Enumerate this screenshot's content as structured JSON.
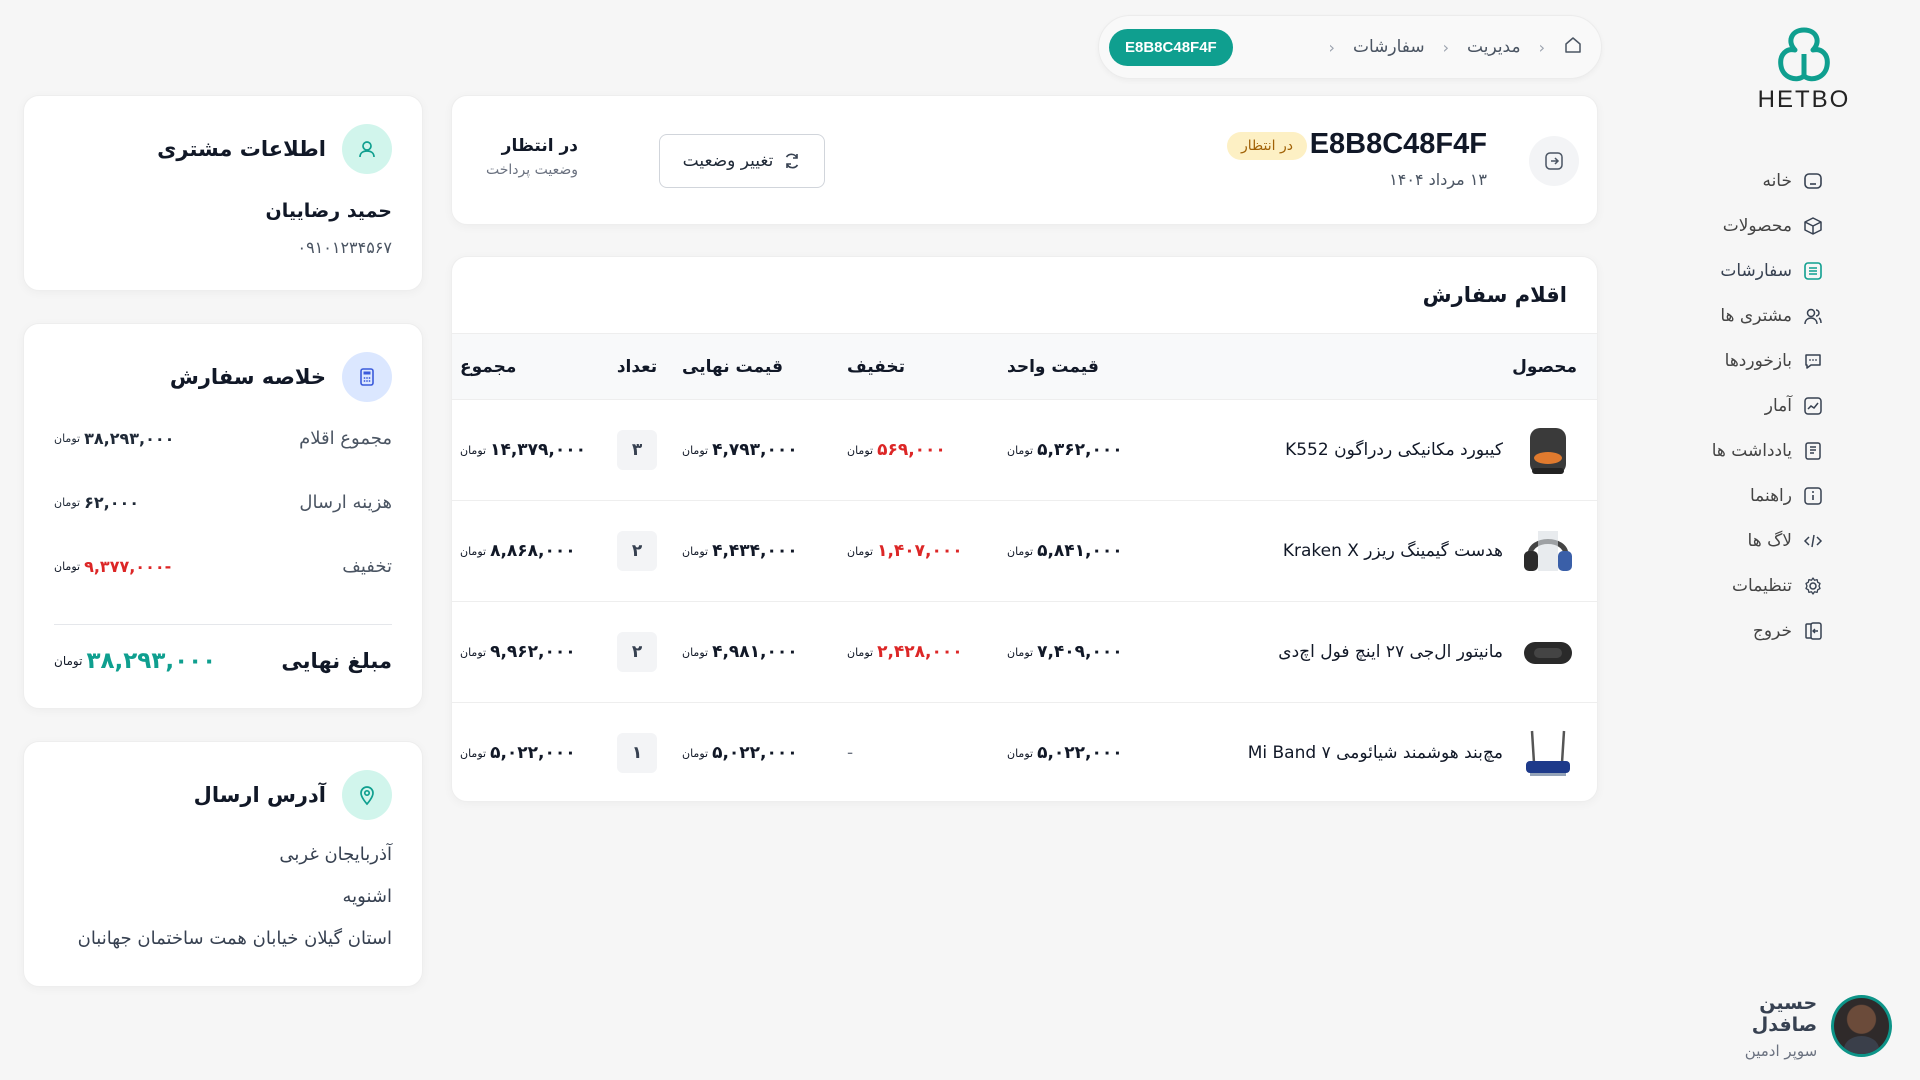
{
  "brand": {
    "name": "HETBO",
    "color": "#0f9f8f"
  },
  "sidebar": {
    "items": [
      {
        "label": "خانه",
        "icon": "home-icon"
      },
      {
        "label": "محصولات",
        "icon": "box-icon"
      },
      {
        "label": "سفارشات",
        "icon": "list-icon",
        "active": true
      },
      {
        "label": "مشتری ها",
        "icon": "users-icon"
      },
      {
        "label": "بازخوردها",
        "icon": "chat-icon"
      },
      {
        "label": "آمار",
        "icon": "chart-icon"
      },
      {
        "label": "یادداشت ها",
        "icon": "note-icon"
      },
      {
        "label": "راهنما",
        "icon": "info-icon"
      },
      {
        "label": "لاگ ها",
        "icon": "code-icon"
      },
      {
        "label": "تنظیمات",
        "icon": "gear-icon"
      },
      {
        "label": "خروج",
        "icon": "logout-icon"
      }
    ]
  },
  "user": {
    "name": "حسین صافدل",
    "role": "سوپر ادمین"
  },
  "breadcrumb": {
    "admin": "مدیریت",
    "orders": "سفارشات",
    "current": "E8B8C48F4F"
  },
  "order": {
    "id": "E8B8C48F4F",
    "status_badge": "در انتظار",
    "date": "۱۳ مرداد ۱۴۰۴",
    "change_status_label": "تغییر وضعیت",
    "payment_status_value": "در انتظار",
    "payment_status_label": "وضعیت پرداخت"
  },
  "items": {
    "title": "اقلام سفارش",
    "currency": "تومان",
    "headers": {
      "product": "محصول",
      "unit_price": "قیمت واحد",
      "discount": "تخفیف",
      "final_price": "قیمت نهایی",
      "qty": "تعداد",
      "total": "مجموع"
    },
    "rows": [
      {
        "product": "کیبورد مکانیکی ردراگون K552",
        "thumb": "speaker",
        "unit_price": "۵,۳۶۲,۰۰۰",
        "discount": "۵۶۹,۰۰۰",
        "final_price": "۴,۷۹۳,۰۰۰",
        "qty": "۳",
        "total": "۱۴,۳۷۹,۰۰۰"
      },
      {
        "product": "هدست گیمینگ ریزر Kraken X",
        "thumb": "headphones",
        "unit_price": "۵,۸۴۱,۰۰۰",
        "discount": "۱,۴۰۷,۰۰۰",
        "final_price": "۴,۴۳۴,۰۰۰",
        "qty": "۲",
        "total": "۸,۸۶۸,۰۰۰"
      },
      {
        "product": "مانیتور ال‌جی ۲۷ اینچ فول اچ‌دی",
        "thumb": "bt-speaker",
        "unit_price": "۷,۴۰۹,۰۰۰",
        "discount": "۲,۴۲۸,۰۰۰",
        "final_price": "۴,۹۸۱,۰۰۰",
        "qty": "۲",
        "total": "۹,۹۶۲,۰۰۰"
      },
      {
        "product": "مچ‌بند هوشمند شیائومی Mi Band ۷",
        "thumb": "router",
        "unit_price": "۵,۰۲۲,۰۰۰",
        "discount": "-",
        "final_price": "۵,۰۲۲,۰۰۰",
        "qty": "۱",
        "total": "۵,۰۲۲,۰۰۰"
      }
    ]
  },
  "customer": {
    "title": "اطلاعات مشتری",
    "name": "حمید رضاییان",
    "phone": "۰۹۱۰۱۲۳۴۵۶۷"
  },
  "summary": {
    "title": "خلاصه سفارش",
    "items_total_label": "مجموع اقلام",
    "items_total": "۳۸,۲۹۳,۰۰۰",
    "shipping_label": "هزینه ارسال",
    "shipping": "۶۲,۰۰۰",
    "discount_label": "تخفیف",
    "discount": "-۹,۳۷۷,۰۰۰",
    "final_label": "مبلغ نهایی",
    "final": "۳۸,۲۹۳,۰۰۰"
  },
  "address": {
    "title": "آدرس ارسال",
    "province": "آذربایجان غربی",
    "city": "اشنویه",
    "street": "استان گیلان خیابان همت ساختمان جهانبان"
  }
}
